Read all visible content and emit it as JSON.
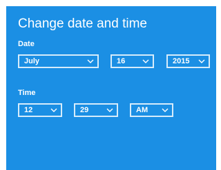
{
  "title": "Change date and time",
  "date": {
    "label": "Date",
    "month": "July",
    "day": "16",
    "year": "2015"
  },
  "time": {
    "label": "Time",
    "hour": "12",
    "minute": "29",
    "period": "AM"
  },
  "colors": {
    "panel": "#1b8fe4",
    "text": "#ffffff",
    "border": "#d6ecfb"
  }
}
